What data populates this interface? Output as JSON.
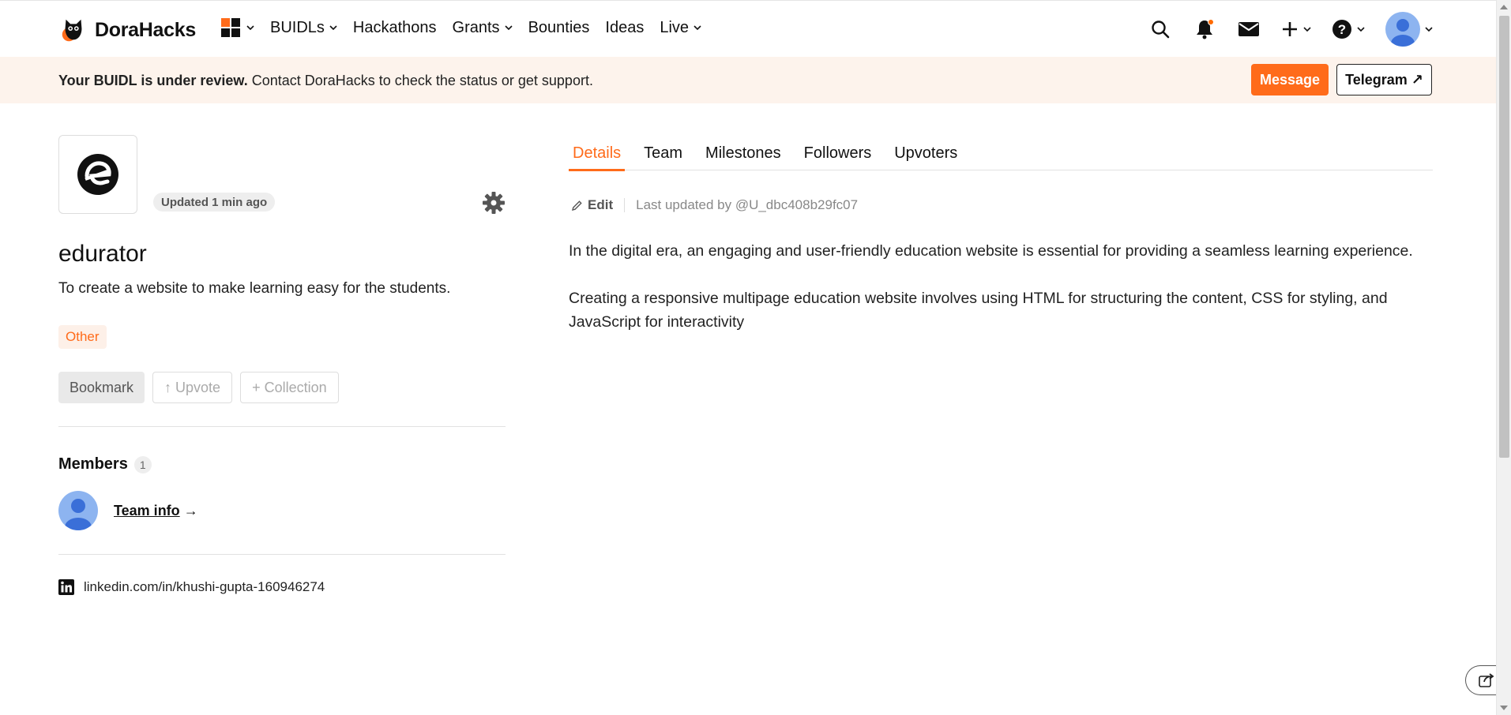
{
  "brand": {
    "name": "DoraHacks"
  },
  "nav": {
    "items": [
      {
        "label": "BUIDLs",
        "has_dropdown": true
      },
      {
        "label": "Hackathons",
        "has_dropdown": false
      },
      {
        "label": "Grants",
        "has_dropdown": true
      },
      {
        "label": "Bounties",
        "has_dropdown": false
      },
      {
        "label": "Ideas",
        "has_dropdown": false
      },
      {
        "label": "Live",
        "has_dropdown": true
      }
    ],
    "right_icons": [
      "search-icon",
      "bell-icon",
      "mail-icon",
      "plus-icon",
      "help-icon",
      "avatar"
    ]
  },
  "banner": {
    "bold": "Your BUIDL is under review.",
    "text": " Contact DoraHacks to check the status or get support.",
    "message_label": "Message",
    "telegram_label": "Telegram ↗"
  },
  "project": {
    "updated": "Updated 1 min ago",
    "title": "edurator",
    "description": "To create a website to make learning easy for the students.",
    "tag": "Other",
    "actions": {
      "bookmark": "Bookmark",
      "upvote": "↑ Upvote",
      "collection": "+ Collection"
    },
    "members_title": "Members",
    "members_count": "1",
    "team_link": "Team info",
    "team_arrow": "→",
    "linkedin": "linkedin.com/in/khushi-gupta-160946274"
  },
  "tabs": [
    {
      "label": "Details",
      "active": true
    },
    {
      "label": "Team",
      "active": false
    },
    {
      "label": "Milestones",
      "active": false
    },
    {
      "label": "Followers",
      "active": false
    },
    {
      "label": "Upvoters",
      "active": false
    }
  ],
  "details": {
    "edit_label": "Edit",
    "last_updated": "Last updated by @U_dbc408b29fc07",
    "paragraphs": [
      "In the digital era, an engaging and user-friendly education website is essential for providing a seamless learning experience.",
      "Creating a responsive multipage education website involves using HTML for structuring the content, CSS for styling, and JavaScript for interactivity"
    ]
  },
  "colors": {
    "accent": "#ff6b1a",
    "banner_bg": "#fdf3ec",
    "tag_bg": "#fdf0e8"
  }
}
